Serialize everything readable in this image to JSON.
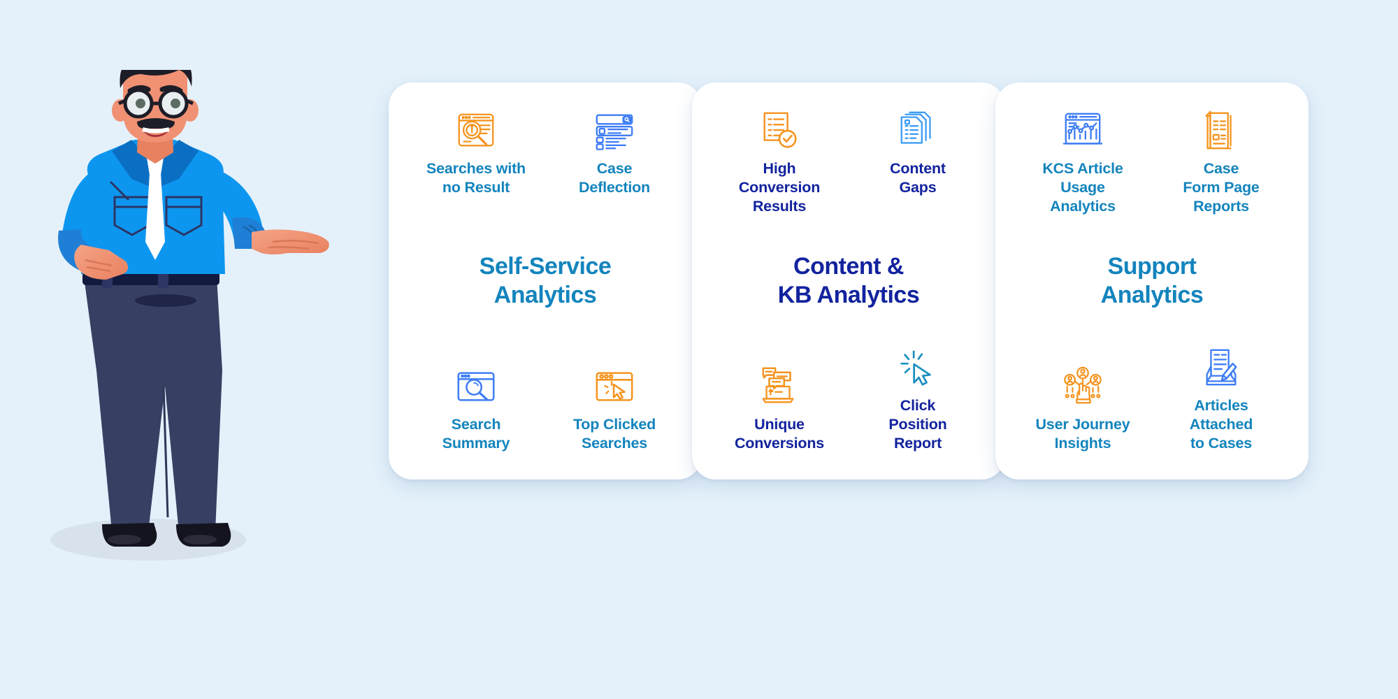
{
  "background_color": "#e4f1fb",
  "illustration": {
    "name": "male-presenter-character",
    "description": "Cartoon man with glasses and mustache presenting with open hand",
    "colors": {
      "shirt": "#0d96ef",
      "shirt_dark": "#0a6fc2",
      "tie": "#ffffff",
      "trousers": "#373f63",
      "belt": "#121a40",
      "shoes": "#14141f",
      "skin": "#f09174",
      "hair": "#1d1d27",
      "shadow": "#d6dfe8"
    }
  },
  "cards": [
    {
      "id": "self-service-analytics",
      "title": "Self-Service\nAnalytics",
      "title_lines": [
        "Self-Service",
        "Analytics"
      ],
      "theme": "teal",
      "accent_color": "#1384bd",
      "tiles_top": [
        {
          "label_lines": [
            "Searches with",
            "no Result"
          ],
          "icon": "search-no-result-icon",
          "icon_color": "#f5941f"
        },
        {
          "label_lines": [
            "Case",
            "Deflection"
          ],
          "icon": "case-deflection-icon",
          "icon_color": "#3e7df5"
        }
      ],
      "tiles_bottom": [
        {
          "label_lines": [
            "Search",
            "Summary"
          ],
          "icon": "search-summary-icon",
          "icon_color": "#3e7df5"
        },
        {
          "label_lines": [
            "Top Clicked",
            "Searches"
          ],
          "icon": "top-clicked-searches-icon",
          "icon_color": "#f5941f"
        }
      ]
    },
    {
      "id": "content-kb-analytics",
      "title": "Content &\nKB Analytics",
      "title_lines": [
        "Content &",
        "KB Analytics"
      ],
      "theme": "navy",
      "accent_color": "#12239e",
      "tiles_top": [
        {
          "label_lines": [
            "High",
            "Conversion",
            "Results"
          ],
          "icon": "high-conversion-results-icon",
          "icon_color": "#f5941f"
        },
        {
          "label_lines": [
            "Content",
            "Gaps"
          ],
          "icon": "content-gaps-icon",
          "icon_color": "#3e9df5"
        }
      ],
      "tiles_bottom": [
        {
          "label_lines": [
            "Unique",
            "Conversions"
          ],
          "icon": "unique-conversions-icon",
          "icon_color": "#f5941f"
        },
        {
          "label_lines": [
            "Click",
            "Position",
            "Report"
          ],
          "icon": "click-position-report-icon",
          "icon_color": "#1a8fbf"
        }
      ]
    },
    {
      "id": "support-analytics",
      "title": "Support\nAnalytics",
      "title_lines": [
        "Support",
        "Analytics"
      ],
      "theme": "teal",
      "accent_color": "#1384bd",
      "tiles_top": [
        {
          "label_lines": [
            "KCS Article",
            "Usage",
            "Analytics"
          ],
          "icon": "kcs-article-usage-analytics-icon",
          "icon_color": "#3e7df5"
        },
        {
          "label_lines": [
            "Case",
            "Form Page",
            "Reports"
          ],
          "icon": "case-form-page-reports-icon",
          "icon_color": "#f5941f"
        }
      ],
      "tiles_bottom": [
        {
          "label_lines": [
            "User Journey",
            "Insights"
          ],
          "icon": "user-journey-insights-icon",
          "icon_color": "#f5941f"
        },
        {
          "label_lines": [
            "Articles",
            "Attached",
            "to Cases"
          ],
          "icon": "articles-attached-to-cases-icon",
          "icon_color": "#3e7df5"
        }
      ]
    }
  ]
}
